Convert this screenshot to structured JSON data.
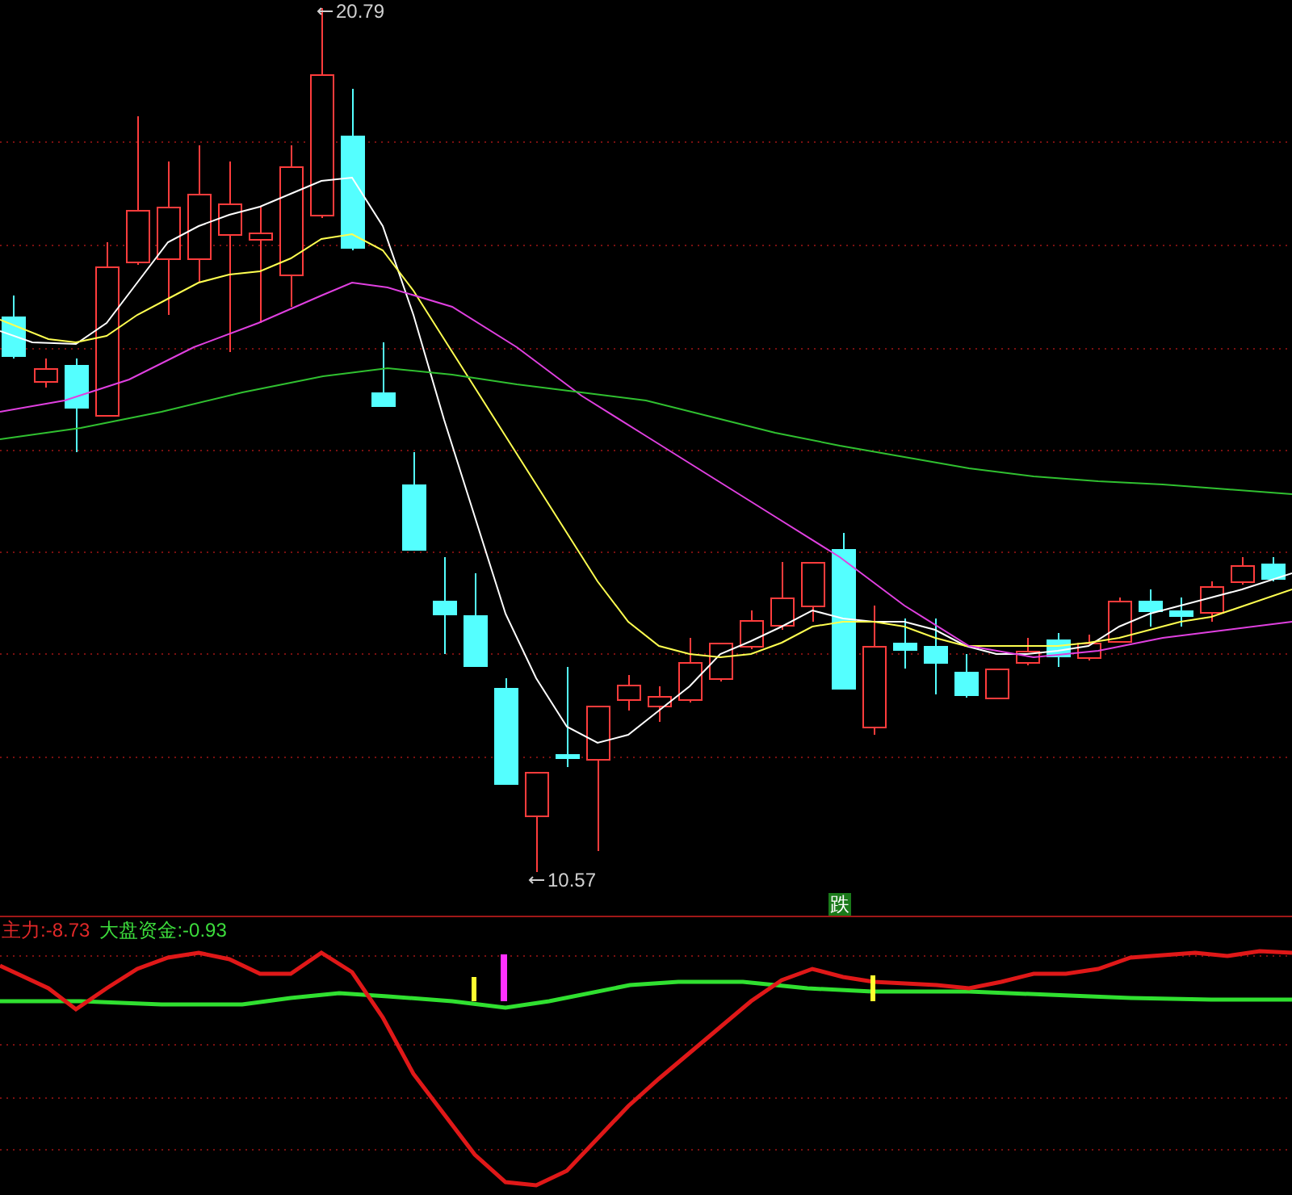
{
  "main_chart": {
    "high_label": "20.79",
    "low_label": "10.57",
    "signal_badge": "跌"
  },
  "indicator_panel": {
    "legend": [
      {
        "text": "主力:-8.73",
        "color": "#e02828"
      },
      {
        "text": "大盘资金:-0.93",
        "color": "#3cdc3c"
      }
    ]
  }
}
